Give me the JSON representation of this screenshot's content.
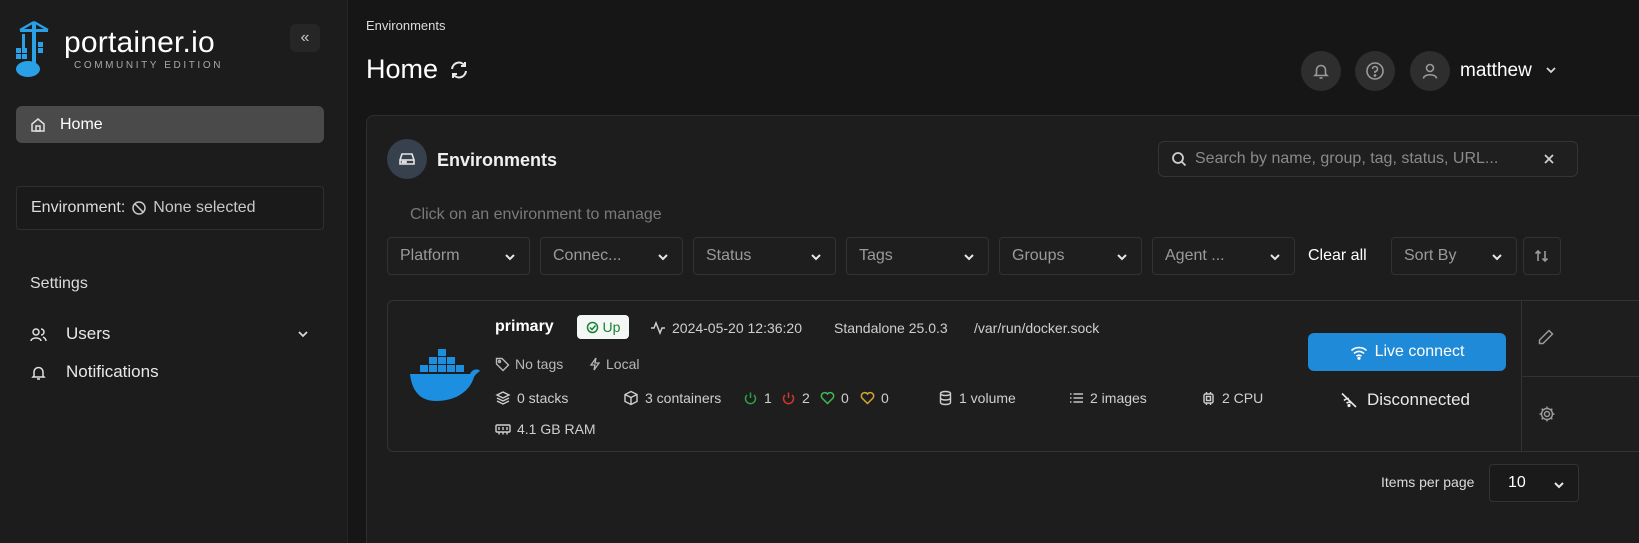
{
  "brand": {
    "name": "portainer.io",
    "edition": "COMMUNITY EDITION"
  },
  "sidebar": {
    "collapse_icon": "«",
    "home_label": "Home",
    "environment_label": "Environment:",
    "environment_value": "None selected",
    "settings_heading": "Settings",
    "items": [
      {
        "label": "Users",
        "icon": "users-icon"
      },
      {
        "label": "Notifications",
        "icon": "bell-icon"
      }
    ]
  },
  "header": {
    "breadcrumb": "Environments",
    "title": "Home",
    "username": "matthew"
  },
  "panel": {
    "title": "Environments",
    "search_placeholder": "Search by name, group, tag, status, URL...",
    "hint": "Click on an environment to manage",
    "filters": [
      "Platform",
      "Connec...",
      "Status",
      "Tags",
      "Groups",
      "Agent ..."
    ],
    "clear_all": "Clear all",
    "sort_by": "Sort By"
  },
  "environment_card": {
    "name": "primary",
    "status": "Up",
    "heartbeat": "2024-05-20 12:36:20",
    "type": "Standalone 25.0.3",
    "url": "/var/run/docker.sock",
    "tags": "No tags",
    "location": "Local",
    "stacks": "0 stacks",
    "containers": "3 containers",
    "running": "1",
    "stopped": "2",
    "healthy": "0",
    "unhealthy": "0",
    "volumes": "1 volume",
    "images": "2 images",
    "cpu": "2 CPU",
    "ram": "4.1 GB RAM",
    "live_connect": "Live connect",
    "connection_state": "Disconnected"
  },
  "pagination": {
    "items_per_page_label": "Items per page",
    "items_per_page": "10"
  },
  "colors": {
    "accent": "#1f8ad8",
    "up": "#1a7f37",
    "running": "#2ea043",
    "stopped": "#d9342b",
    "healthy": "#3fb950",
    "unhealthy": "#d4a72c"
  }
}
